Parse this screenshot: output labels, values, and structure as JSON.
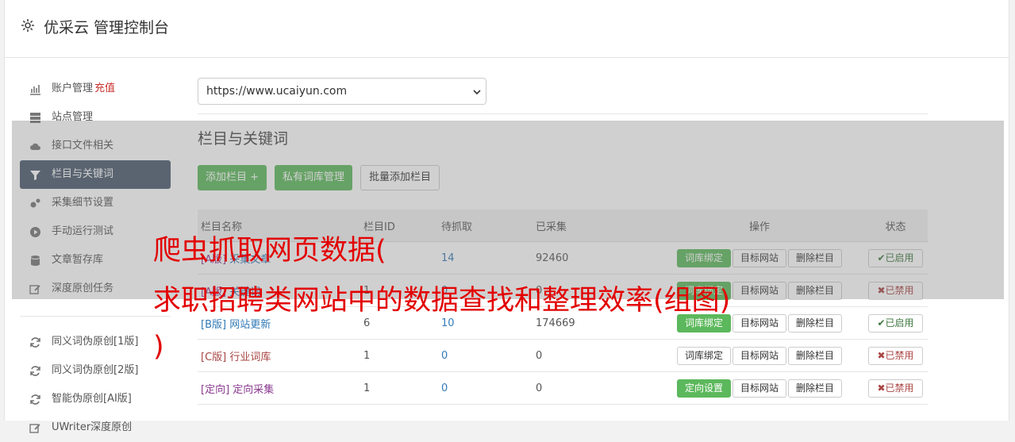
{
  "header": {
    "title": "优采云 管理控制台"
  },
  "sidebar": {
    "items": [
      {
        "label": "账户管理",
        "extra": "充值",
        "icon": "bar-chart-icon"
      },
      {
        "label": "站点管理",
        "icon": "server-icon"
      },
      {
        "label": "接口文件相关",
        "icon": "cloud-upload-icon"
      },
      {
        "label": "栏目与关键词",
        "icon": "filter-icon"
      },
      {
        "label": "采集细节设置",
        "icon": "cogs-icon"
      },
      {
        "label": "手动运行测试",
        "icon": "play-circle-icon"
      },
      {
        "label": "文章暂存库",
        "icon": "database-icon"
      },
      {
        "label": "深度原创任务",
        "icon": "edit-icon"
      }
    ],
    "items2": [
      {
        "label": "同义词伪原创[1版]",
        "icon": "refresh-icon"
      },
      {
        "label": "同义词伪原创[2版]",
        "icon": "refresh-icon"
      },
      {
        "label": "智能伪原创[AI版]",
        "icon": "refresh-icon"
      },
      {
        "label": "UWriter深度原创",
        "icon": "edit-icon"
      }
    ]
  },
  "main": {
    "site_select": "https://www.ucaiyun.com",
    "section_title": "栏目与关键词",
    "buttons": {
      "add": "添加栏目 +",
      "private": "私有词库管理",
      "batch": "批量添加栏目"
    },
    "table": {
      "headers": [
        "栏目名称",
        "栏目ID",
        "待抓取",
        "已采集",
        "操作",
        "状态"
      ],
      "rows": [
        {
          "tag": "[A版]",
          "name": "采集文章",
          "id": "",
          "pending": "14",
          "done": "92460",
          "op1": "词库绑定",
          "op2": "目标网站",
          "op3": "删除栏目",
          "status": "✔已启用"
        },
        {
          "tag": "[A版]",
          "name": "关键词",
          "id": "1",
          "pending": "0",
          "done": "0",
          "op1": "词库绑定",
          "op2": "目标网站",
          "op3": "删除栏目",
          "status": "✖已禁用"
        },
        {
          "tag": "[B版]",
          "name": "网站更新",
          "id": "6",
          "pending": "10",
          "done": "174669",
          "op1": "词库绑定",
          "op2": "目标网站",
          "op3": "删除栏目",
          "status": "✔已启用"
        },
        {
          "tag": "[C版]",
          "name": "行业词库",
          "id": "1",
          "pending": "0",
          "done": "0",
          "op1": "词库绑定",
          "op2": "目标网站",
          "op3": "删除栏目",
          "status": "✖已禁用"
        },
        {
          "tag": "[定向]",
          "name": "定向采集",
          "id": "1",
          "pending": "0",
          "done": "0",
          "op1": "定向设置",
          "op2": "目标网站",
          "op3": "删除栏目",
          "status": "✖已禁用"
        }
      ]
    }
  },
  "watermark": {
    "line1": "爬虫抓取网页数据(",
    "line2": "求职招聘类网站中的数据查找和整理效率(组图)",
    "line3": ")"
  },
  "colors": {
    "accent_green": "#5cb85c",
    "active_nav": "#4a5a6e",
    "watermark": "#e30000"
  }
}
